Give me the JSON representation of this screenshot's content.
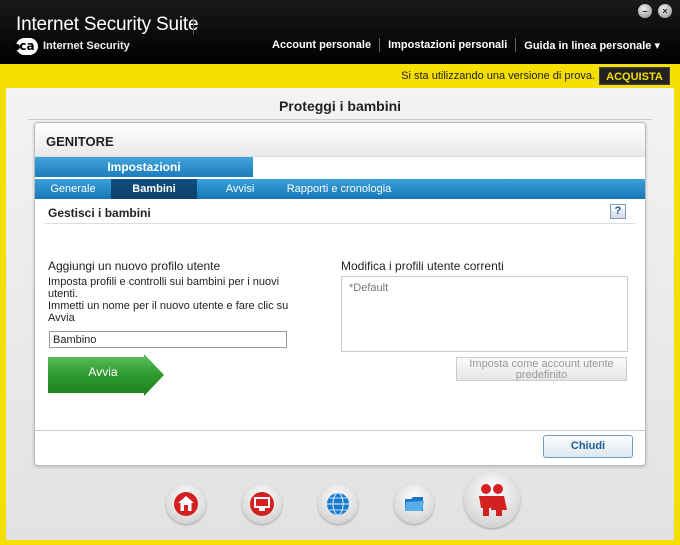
{
  "window": {
    "title": "Internet Security Suite",
    "brand_logo": "ca",
    "brand_sub": "Internet Security",
    "minimize_icon": "minimize-icon",
    "close_icon": "close-icon"
  },
  "topnav": {
    "items": [
      "Account personale",
      "Impostazioni personali",
      "Guida in linea personale ▾"
    ]
  },
  "trial": {
    "message": "Si sta utilizzando una versione di prova.",
    "buy_label": "ACQUISTA"
  },
  "page": {
    "heading": "Proteggi i bambini"
  },
  "panel": {
    "title": "GENITORE",
    "settings_tab": "Impostazioni",
    "subtabs": [
      "Generale",
      "Bambini",
      "Avvisi",
      "Rapporti e cronologia"
    ],
    "active_subtab": "Bambini",
    "section_title": "Gestisci i bambini",
    "help_label": "?"
  },
  "add_profile": {
    "title": "Aggiungi un nuovo profilo utente",
    "desc_lines": [
      "Imposta profili e controlli sui bambini per i nuovi",
      "utenti.",
      "Immetti un nome per il nuovo utente e fare clic su",
      "Avvia"
    ],
    "input_value": "Bambino",
    "start_label": "Avvia"
  },
  "edit_profiles": {
    "title": "Modifica i profili utente correnti",
    "profiles": [
      "*Default"
    ],
    "set_default_label_lines": [
      "Imposta come account utente",
      "predefinito"
    ]
  },
  "footer": {
    "close_label": "Chiudi"
  },
  "dock": {
    "items": [
      "home-icon",
      "monitor-icon",
      "globe-icon",
      "folder-icon",
      "parents-icon"
    ]
  },
  "colors": {
    "trial_bar": "#f5df00",
    "tab_blue": "#1b7cbf",
    "start_green": "#2e9a2e"
  }
}
